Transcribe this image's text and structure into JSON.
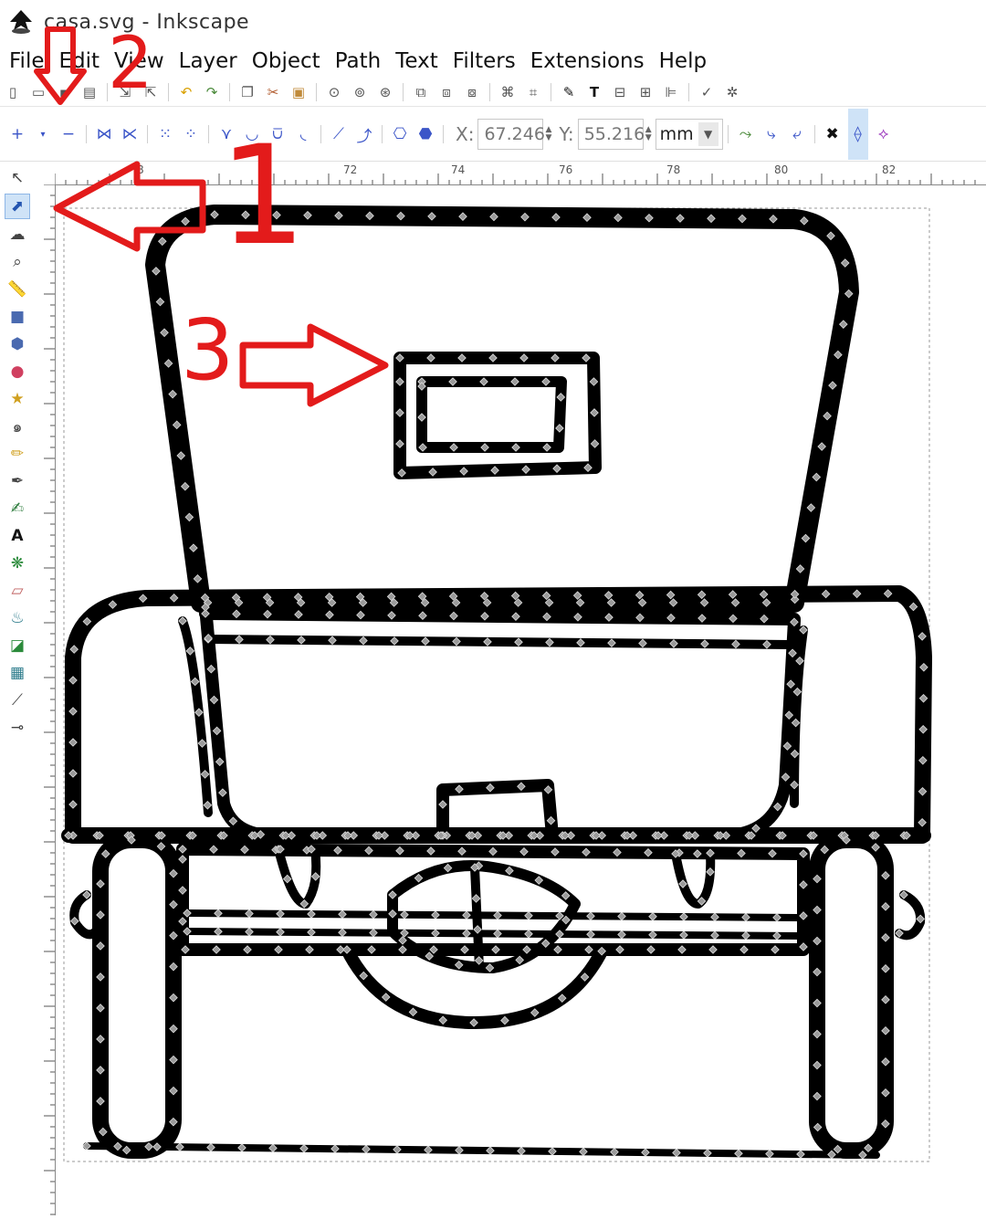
{
  "window": {
    "title": "casa.svg - Inkscape"
  },
  "menu": [
    "File",
    "Edit",
    "View",
    "Layer",
    "Object",
    "Path",
    "Text",
    "Filters",
    "Extensions",
    "Help"
  ],
  "coords": {
    "x_label": "X:",
    "x_value": "67.246",
    "y_label": "Y:",
    "y_value": "55.216",
    "unit": "mm"
  },
  "ruler": {
    "top_labels": [
      "8",
      "72",
      "74",
      "76",
      "78",
      "80",
      "82"
    ]
  },
  "annotations": {
    "one": "1",
    "two": "2",
    "three": "3"
  },
  "colors": {
    "annotation": "#e31b1b",
    "active_tool": "#cfe3f7",
    "node": "#9a9a9a",
    "stroke": "#000000"
  },
  "icons": {
    "toolbox": [
      "selector-icon",
      "node-editor-icon",
      "tweak-icon",
      "zoom-icon",
      "measure-icon",
      "rectangle-icon",
      "3d-box-icon",
      "ellipse-icon",
      "star-icon",
      "spiral-icon",
      "pencil-icon",
      "pen-icon",
      "calligraphy-icon",
      "text-icon",
      "spray-icon",
      "eraser-icon",
      "bucket-icon",
      "gradient-icon",
      "mesh-icon",
      "dropper-icon",
      "connector-icon"
    ]
  }
}
